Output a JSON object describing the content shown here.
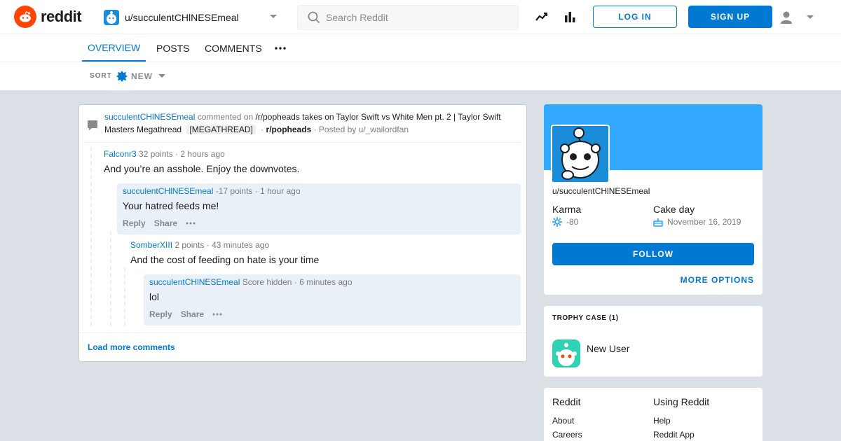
{
  "header": {
    "logo_text": "reddit",
    "username": "u/succulentCHlNESEmeal",
    "search_placeholder": "Search Reddit",
    "login_label": "LOG IN",
    "signup_label": "SIGN UP"
  },
  "tabs": [
    "OVERVIEW",
    "POSTS",
    "COMMENTS"
  ],
  "sort": {
    "label": "SORT",
    "value": "NEW"
  },
  "post": {
    "author": "succulentCHlNESEmeal",
    "action": "commented on",
    "title": "/r/popheads takes on Taylor Swift vs White Men pt. 2 | Taylor Swift Masters Megathread",
    "flair": "[MEGATHREAD]",
    "dot": "·",
    "subreddit": "r/popheads",
    "posted_by": "· Posted by u/_wailordfan"
  },
  "comments": [
    {
      "user": "Falconr3",
      "score": "32 points",
      "time": "· 2 hours ago",
      "body": "And you’re an asshole. Enjoy the downvotes."
    },
    {
      "user": "succulentCHlNESEmeal",
      "score": "-17 points",
      "time": "· 1 hour ago",
      "body": "Your hatred feeds me!"
    },
    {
      "user": "SomberXIII",
      "score": "2 points",
      "time": "· 43 minutes ago",
      "body": "And the cost of feeding on hate is your time"
    },
    {
      "user": "succulentCHlNESEmeal",
      "score": "Score hidden",
      "time": "· 6 minutes ago",
      "body": "lol"
    }
  ],
  "comment_actions": {
    "reply": "Reply",
    "share": "Share"
  },
  "load_more": "Load more comments",
  "profile": {
    "username": "u/succulentCHlNESEmeal",
    "karma_label": "Karma",
    "karma_value": "-80",
    "cakeday_label": "Cake day",
    "cakeday_value": "November 16, 2019",
    "follow_label": "FOLLOW",
    "more_options_label": "MORE OPTIONS"
  },
  "trophy": {
    "title": "TROPHY CASE (1)",
    "name": "New User"
  },
  "footer_links": {
    "col1": {
      "heading": "Reddit",
      "items": [
        "About",
        "Careers"
      ]
    },
    "col2": {
      "heading": "Using Reddit",
      "items": [
        "Help",
        "Reddit App"
      ]
    }
  },
  "colors": {
    "accent": "#0079d3",
    "brand": "#ff4500",
    "banner": "#33a8ff",
    "background": "#dae0e6"
  }
}
